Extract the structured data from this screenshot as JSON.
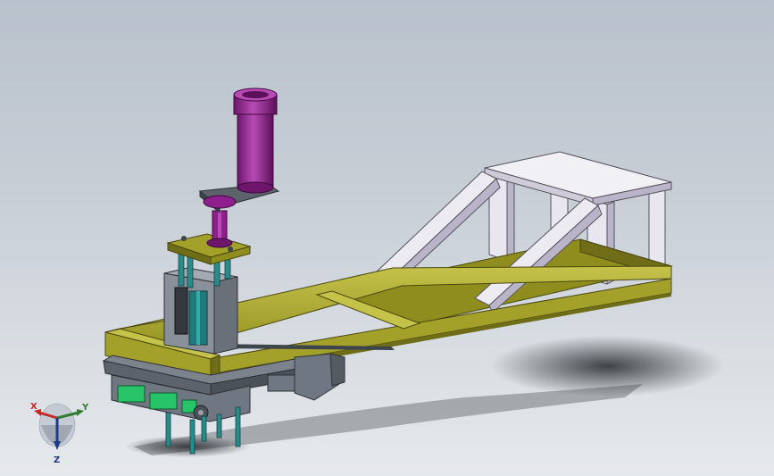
{
  "viewport": {
    "background_top": "#b9c1cc",
    "background_bottom": "#e6e9ec"
  },
  "model": {
    "colors": {
      "frame": "#a3a12a",
      "frame_dark": "#6f6d18",
      "frame_light": "#c5c24a",
      "stand": "#e8e6ee",
      "stand_shade": "#b9b4c8",
      "motor": "#8f1f8c",
      "motor_light": "#b64bb5",
      "mechanism": "#6f7782",
      "shaft": "#2b8a8a",
      "actuator": "#27c46a",
      "shadow": "#3a3d43"
    }
  },
  "triad": {
    "x_label": "X",
    "y_label": "Y",
    "z_label": "Z"
  }
}
